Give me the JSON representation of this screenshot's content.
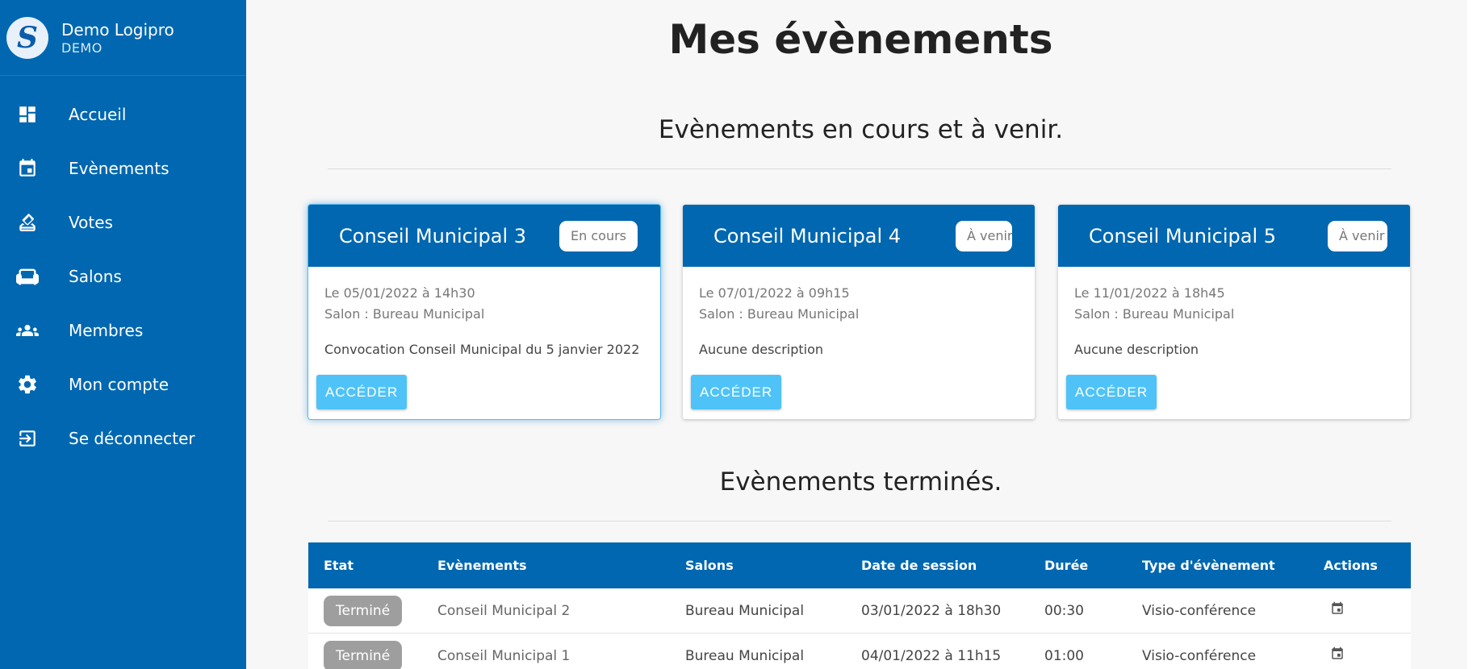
{
  "brand": {
    "name": "Demo Logipro",
    "subtitle": "DEMO",
    "logo_letter": "S"
  },
  "sidebar": {
    "items": [
      {
        "label": "Accueil",
        "icon": "dashboard-icon"
      },
      {
        "label": "Evènements",
        "icon": "calendar-icon"
      },
      {
        "label": "Votes",
        "icon": "ballot-box-icon"
      },
      {
        "label": "Salons",
        "icon": "couch-icon"
      },
      {
        "label": "Membres",
        "icon": "group-icon"
      },
      {
        "label": "Mon compte",
        "icon": "gear-icon"
      },
      {
        "label": "Se déconnecter",
        "icon": "logout-icon"
      }
    ]
  },
  "main": {
    "title": "Mes évènements",
    "upcoming_title": "Evènements en cours et à venir.",
    "finished_title": "Evènements terminés.",
    "cards": [
      {
        "title": "Conseil Municipal 3",
        "status": "En cours",
        "date": "Le 05/01/2022 à 14h30",
        "salon": "Salon : Bureau Municipal",
        "description": "Convocation Conseil Municipal du 5 janvier 2022",
        "button": "ACCÉDER"
      },
      {
        "title": "Conseil Municipal 4",
        "status": "À venir",
        "date": "Le 07/01/2022 à 09h15",
        "salon": "Salon : Bureau Municipal",
        "description": "Aucune description",
        "button": "ACCÉDER"
      },
      {
        "title": "Conseil Municipal 5",
        "status": "À venir",
        "date": "Le 11/01/2022 à 18h45",
        "salon": "Salon : Bureau Municipal",
        "description": "Aucune description",
        "button": "ACCÉDER"
      }
    ],
    "table": {
      "headers": [
        "Etat",
        "Evènements",
        "Salons",
        "Date de session",
        "Durée",
        "Type d'évènement",
        "Actions"
      ],
      "rows": [
        {
          "status": "Terminé",
          "event": "Conseil Municipal 2",
          "salon": "Bureau Municipal",
          "date": "03/01/2022 à 18h30",
          "duration": "00:30",
          "type": "Visio-conférence",
          "action_icon": "calendar-icon"
        },
        {
          "status": "Terminé",
          "event": "Conseil Municipal 1",
          "salon": "Bureau Municipal",
          "date": "04/01/2022 à 11h15",
          "duration": "01:00",
          "type": "Visio-conférence",
          "action_icon": "calendar-icon"
        }
      ]
    }
  },
  "colors": {
    "primary": "#0067b0",
    "accent": "#4fc3f7",
    "status_done": "#9e9e9e"
  }
}
